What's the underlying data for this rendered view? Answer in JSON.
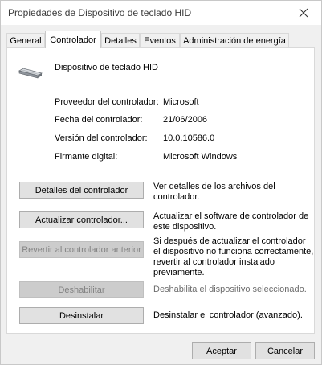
{
  "window": {
    "title": "Propiedades de Dispositivo de teclado HID",
    "close_icon": "close-icon"
  },
  "tabs": [
    {
      "label": "General",
      "active": false
    },
    {
      "label": "Controlador",
      "active": true
    },
    {
      "label": "Detalles",
      "active": false
    },
    {
      "label": "Eventos",
      "active": false
    },
    {
      "label": "Administración de energía",
      "active": false
    }
  ],
  "device": {
    "icon": "keyboard-icon",
    "name": "Dispositivo de teclado HID"
  },
  "properties": [
    {
      "label": "Proveedor del controlador:",
      "value": "Microsoft"
    },
    {
      "label": "Fecha del controlador:",
      "value": "21/06/2006"
    },
    {
      "label": "Versión del controlador:",
      "value": "10.0.10586.0"
    },
    {
      "label": "Firmante digital:",
      "value": "Microsoft Windows"
    }
  ],
  "actions": [
    {
      "button": "Detalles del controlador",
      "enabled": true,
      "description": "Ver detalles de los archivos del controlador."
    },
    {
      "button": "Actualizar controlador...",
      "enabled": true,
      "description": "Actualizar el software de controlador de este dispositivo."
    },
    {
      "button": "Revertir al controlador anterior",
      "enabled": false,
      "description": "Si después de actualizar el controlador el dispositivo no funciona correctamente, revertir al controlador instalado previamente."
    },
    {
      "button": "Deshabilitar",
      "enabled": false,
      "description": "Deshabilita el dispositivo seleccionado."
    },
    {
      "button": "Desinstalar",
      "enabled": true,
      "description": "Desinstalar el controlador (avanzado)."
    }
  ],
  "footer": {
    "ok_label": "Aceptar",
    "cancel_label": "Cancelar"
  }
}
